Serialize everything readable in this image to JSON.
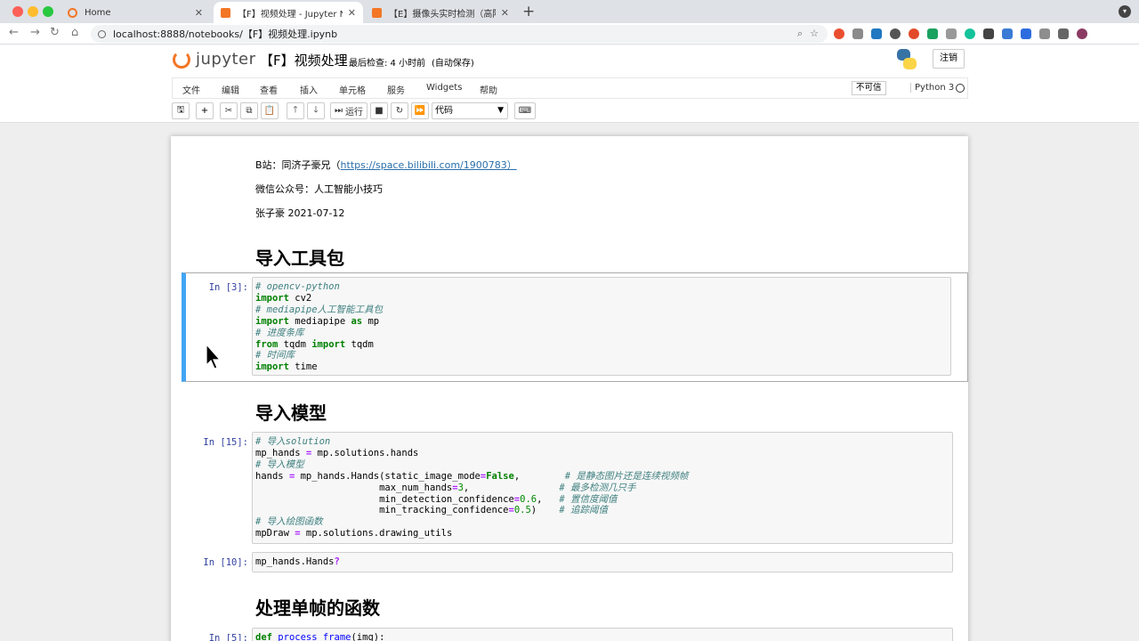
{
  "browser": {
    "tabs": [
      {
        "label": "Home"
      },
      {
        "label": "【F】视频处理 - Jupyter Notebook"
      },
      {
        "label": "【E】摄像头实时检测（高阶） - Jupyter Notebook"
      }
    ],
    "url": "localhost:8888/notebooks/【F】视频处理.ipynb"
  },
  "jupyter": {
    "logo_text": "jupyter",
    "notebook_title": "【F】视频处理",
    "checkpoint": "最后检查: 4 小时前",
    "autosave": "(自动保存)",
    "logout": "注销",
    "menu": [
      "文件",
      "编辑",
      "查看",
      "插入",
      "单元格",
      "服务",
      "Widgets",
      "帮助"
    ],
    "trust": "不可信",
    "kernel": "Python 3",
    "toolbar": {
      "run": "运行",
      "cell_type": "代码"
    }
  },
  "notebook": {
    "intro_bilibili_prefix": "B站：同济子豪兄（",
    "intro_bilibili_link": "https://space.bilibili.com/1900783）",
    "intro_wechat": "微信公众号：人工智能小技巧",
    "intro_author": "张子豪 2021-07-12",
    "heading1": "导入工具包",
    "heading2": "导入模型",
    "heading3": "处理单帧的函数",
    "cell1_prompt": "In [3]:",
    "cell2_prompt": "In [15]:",
    "cell3_prompt": "In [10]:",
    "cell4_prompt": "In [5]:",
    "cell1_code": [
      "# opencv-python",
      "import cv2",
      "# mediapipe人工智能工具包",
      "import mediapipe as mp",
      "# 进度条库",
      "from tqdm import tqdm",
      "# 时间库",
      "import time"
    ],
    "cell2_code": [
      "# 导入solution",
      "mp_hands = mp.solutions.hands",
      "# 导入模型",
      "hands = mp_hands.Hands(static_image_mode=False,        # 是静态图片还是连续视频帧",
      "                      max_num_hands=3,                # 最多检测几只手",
      "                      min_detection_confidence=0.6,   # 置信度阈值",
      "                      min_tracking_confidence=0.5)    # 追踪阈值",
      "# 导入绘图函数",
      "mpDraw = mp.solutions.drawing_utils"
    ],
    "cell3_code": "mp_hands.Hands?",
    "cell4_code": "def process_frame(img):"
  }
}
